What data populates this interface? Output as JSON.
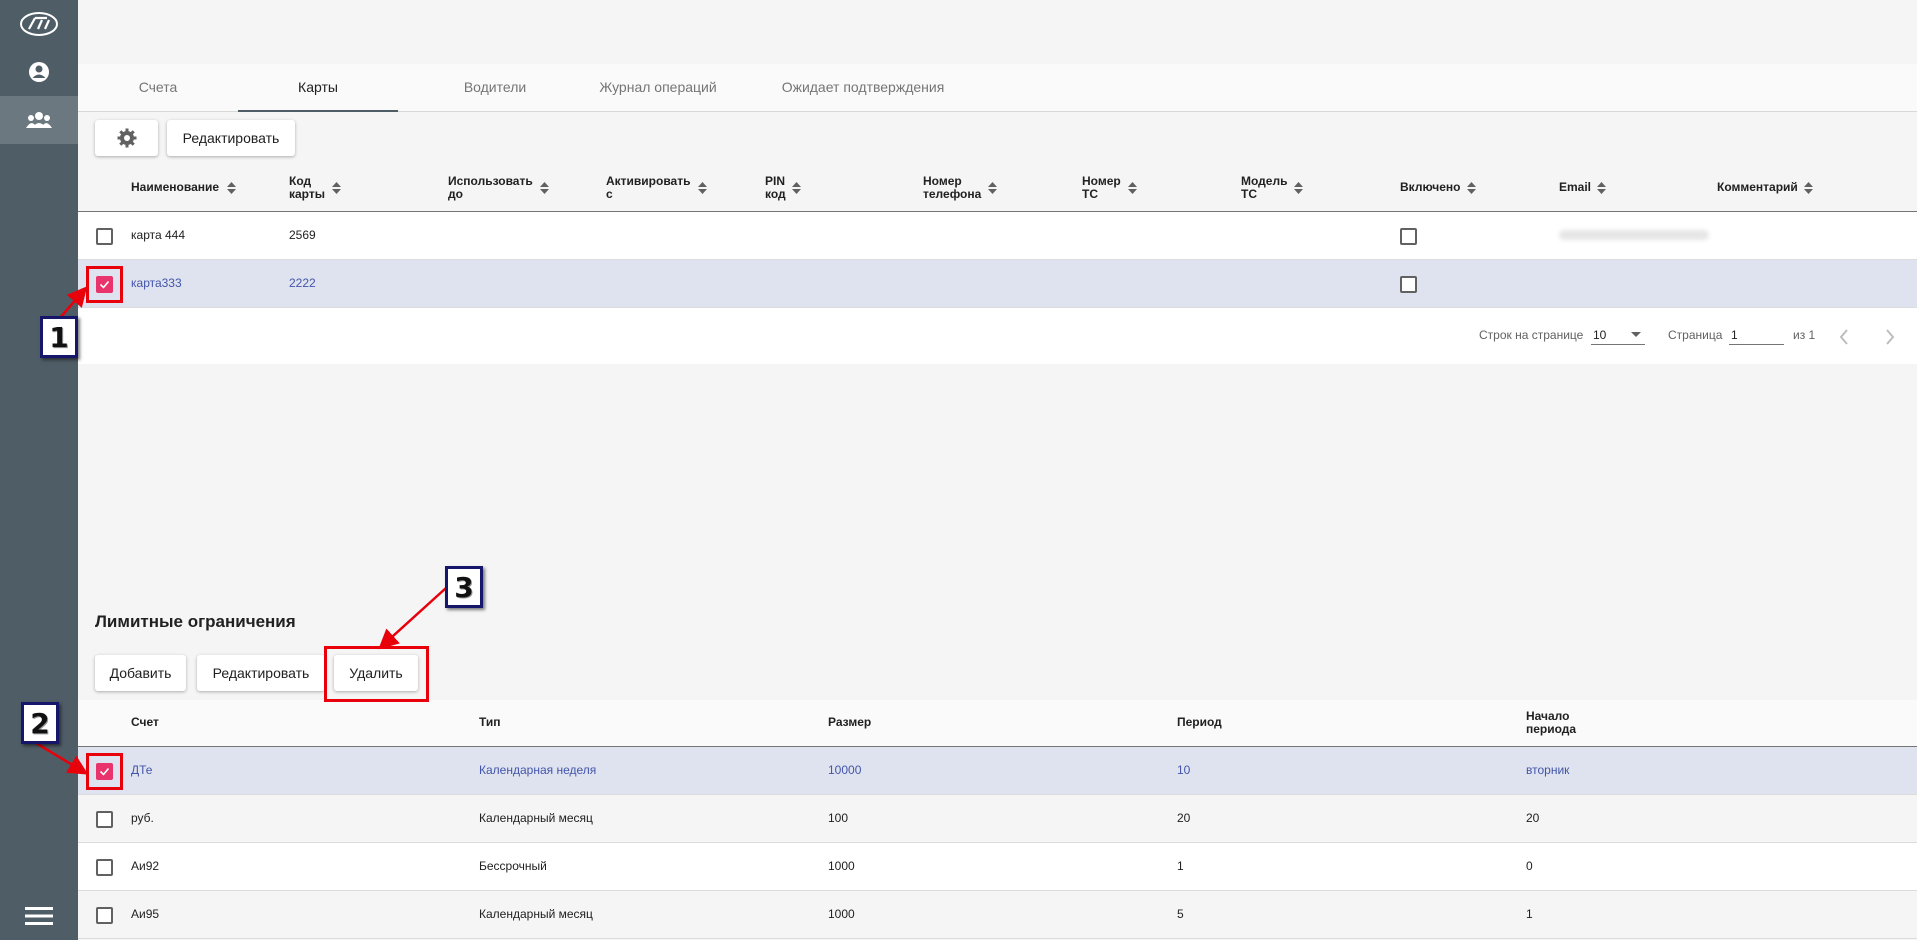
{
  "tabs": [
    {
      "label": "Счета"
    },
    {
      "label": "Карты"
    },
    {
      "label": "Водители"
    },
    {
      "label": "Журнал операций"
    },
    {
      "label": "Ожидает подтверждения"
    }
  ],
  "toolbar": {
    "edit_label": "Редактировать"
  },
  "cards_table": {
    "headers": [
      {
        "l1": "Наименование",
        "l2": ""
      },
      {
        "l1": "Код",
        "l2": "карты"
      },
      {
        "l1": "Использовать",
        "l2": "до"
      },
      {
        "l1": "Активировать",
        "l2": "с"
      },
      {
        "l1": "PIN",
        "l2": "код"
      },
      {
        "l1": "Номер",
        "l2": "телефона"
      },
      {
        "l1": "Номер",
        "l2": "ТС"
      },
      {
        "l1": "Модель",
        "l2": "ТС"
      },
      {
        "l1": "Включено",
        "l2": ""
      },
      {
        "l1": "Email",
        "l2": ""
      },
      {
        "l1": "Комментарий",
        "l2": ""
      }
    ],
    "rows": [
      {
        "name": "карта 444",
        "code": "2569",
        "selected": false,
        "enabled": false
      },
      {
        "name": "карта333",
        "code": "2222",
        "selected": true,
        "enabled": false
      }
    ]
  },
  "pagination": {
    "rows_per_page_label": "Строк на странице",
    "rows_per_page_value": "10",
    "page_label": "Страница",
    "page_value": "1",
    "of_label": "из 1"
  },
  "limits": {
    "title": "Лимитные ограничения",
    "add_label": "Добавить",
    "edit_label": "Редактировать",
    "delete_label": "Удалить",
    "headers": [
      {
        "l1": "Счет",
        "l2": ""
      },
      {
        "l1": "Тип",
        "l2": ""
      },
      {
        "l1": "Размер",
        "l2": ""
      },
      {
        "l1": "Период",
        "l2": ""
      },
      {
        "l1": "Начало",
        "l2": "периода"
      }
    ],
    "rows": [
      {
        "account": "ДТе",
        "type": "Календарная неделя",
        "size": "10000",
        "period": "10",
        "start": "вторник",
        "selected": true
      },
      {
        "account": "руб.",
        "type": "Календарный месяц",
        "size": "100",
        "period": "20",
        "start": "20",
        "selected": false
      },
      {
        "account": "Аи92",
        "type": "Бессрочный",
        "size": "1000",
        "period": "1",
        "start": "0",
        "selected": false
      },
      {
        "account": "Аи95",
        "type": "Календарный месяц",
        "size": "1000",
        "period": "5",
        "start": "1",
        "selected": false
      }
    ]
  },
  "callouts": [
    "1",
    "2",
    "3"
  ],
  "colors": {
    "accent": "#e8336d",
    "selected_row": "#dfe3f0",
    "sidebar": "#4f5d66",
    "annotation_red": "#e8000b",
    "annotation_navy": "#16166b"
  },
  "icons": [
    "logo-icon",
    "user-icon",
    "group-icon",
    "menu-icon",
    "gear-icon",
    "sort-icon",
    "checkbox-icon",
    "chevron-left-icon",
    "chevron-right-icon",
    "dropdown-icon"
  ]
}
